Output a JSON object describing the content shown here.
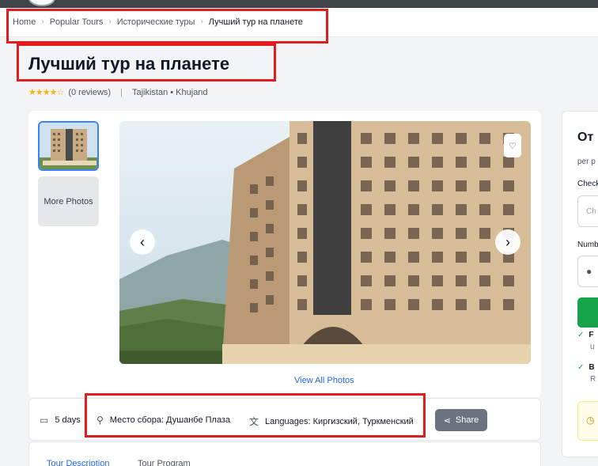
{
  "breadcrumb": {
    "items": [
      "Home",
      "Popular Tours",
      "Исторические туры"
    ],
    "current": "Лучший тур на планете",
    "separator": "›"
  },
  "tour": {
    "title": "Лучший тур на планете",
    "rating_stars": "★★★★☆",
    "reviews": "(0 reviews)",
    "location": "Tajikistan • Khujand"
  },
  "gallery": {
    "more_photos": "More Photos",
    "view_all": "View All Photos",
    "prev_icon": "‹",
    "next_icon": "›",
    "favorite_icon": "♡"
  },
  "info": {
    "duration": "5 days",
    "meeting_point": "Место сбора: Душанбе Плаза",
    "languages": "Languages: Киргизский, Туркменский",
    "share": "Share"
  },
  "tabs": [
    {
      "label": "Tour Description",
      "active": true
    },
    {
      "label": "Tour Program",
      "active": false
    }
  ],
  "booking": {
    "from": "От",
    "per": "per p",
    "checkin_label": "Check",
    "checkin_placeholder": "Ch",
    "number_label": "Numb",
    "feature1_title": "F",
    "feature1_sub": "u",
    "feature2_title": "B",
    "feature2_sub": "R"
  },
  "colors": {
    "accent": "#2563eb",
    "book_button": "#16a34a",
    "highlight": "#e11d1d",
    "star": "#f5b50a"
  }
}
